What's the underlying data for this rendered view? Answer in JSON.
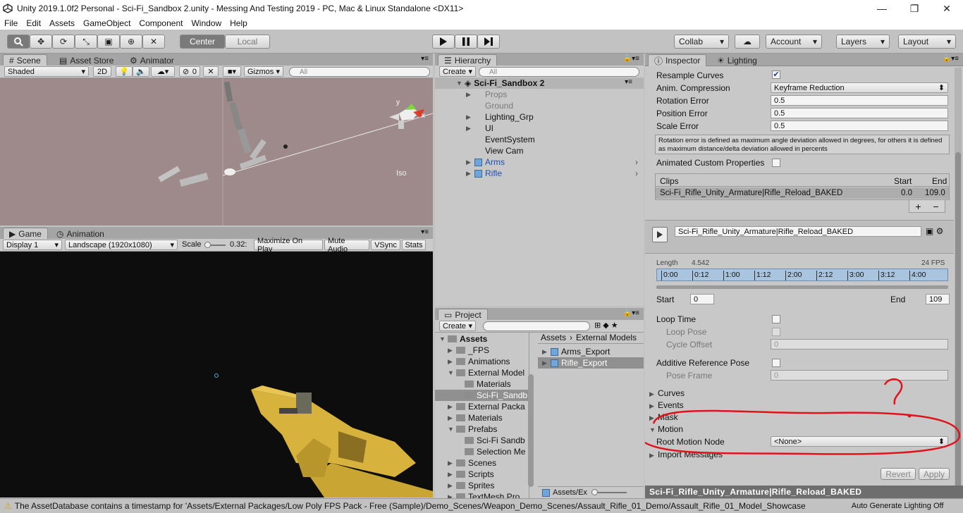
{
  "window": {
    "title": "Unity 2019.1.0f2 Personal - Sci-Fi_Sandbox 2.unity - Messing And Testing 2019 - PC, Mac & Linux Standalone <DX11>",
    "min": "—",
    "max": "❐",
    "close": "✕"
  },
  "menu": [
    "File",
    "Edit",
    "Assets",
    "GameObject",
    "Component",
    "Window",
    "Help"
  ],
  "toolbar": {
    "center": "Center",
    "local": "Local",
    "collab": "Collab",
    "account": "Account",
    "layers": "Layers",
    "layout": "Layout"
  },
  "scene": {
    "tabs": [
      "Scene",
      "Asset Store",
      "Animator"
    ],
    "shaded": "Shaded",
    "mode2d": "2D",
    "fx_count": "0",
    "gizmos": "Gizmos",
    "search_placeholder": "All",
    "iso": "Iso",
    "gizmo_y": "y",
    "gizmo_x": "x"
  },
  "game": {
    "tabs": [
      "Game",
      "Animation"
    ],
    "display": "Display 1",
    "aspect": "Landscape (1920x1080)",
    "scale_label": "Scale",
    "scale_value": "0.32:",
    "maximize": "Maximize On Play",
    "mute": "Mute Audio",
    "vsync": "VSync",
    "stats": "Stats"
  },
  "hierarchy": {
    "tab": "Hierarchy",
    "create": "Create",
    "search_placeholder": "All",
    "scene_name": "Sci-Fi_Sandbox 2",
    "items": [
      {
        "label": "Props",
        "expand": true,
        "dim": true
      },
      {
        "label": "Ground",
        "expand": false,
        "dim": true
      },
      {
        "label": "Lighting_Grp",
        "expand": true
      },
      {
        "label": "UI",
        "expand": true
      },
      {
        "label": "EventSystem",
        "expand": false
      },
      {
        "label": "View Cam",
        "expand": false
      },
      {
        "label": "Arms",
        "expand": true,
        "prefab": true
      },
      {
        "label": "Rifle",
        "expand": true,
        "prefab": true
      }
    ]
  },
  "project": {
    "tab": "Project",
    "create": "Create",
    "tree": [
      {
        "label": "Assets",
        "level": 0,
        "open": true,
        "bold": true
      },
      {
        "label": "_FPS",
        "level": 1
      },
      {
        "label": "Animations",
        "level": 1
      },
      {
        "label": "External Model",
        "level": 1,
        "open": true
      },
      {
        "label": "Materials",
        "level": 2
      },
      {
        "label": "Sci-Fi_Sandb",
        "level": 2,
        "selected": true
      },
      {
        "label": "External Packa",
        "level": 1
      },
      {
        "label": "Materials",
        "level": 1
      },
      {
        "label": "Prefabs",
        "level": 1,
        "open": true
      },
      {
        "label": "Sci-Fi Sandb",
        "level": 2
      },
      {
        "label": "Selection Me",
        "level": 2
      },
      {
        "label": "Scenes",
        "level": 1
      },
      {
        "label": "Scripts",
        "level": 1
      },
      {
        "label": "Sprites",
        "level": 1
      },
      {
        "label": "TextMesh Pro",
        "level": 1
      }
    ],
    "breadcrumb": [
      "Assets",
      "External Models"
    ],
    "files": [
      "Arms_Export",
      "Rifle_Export"
    ],
    "footer_path": "Assets/Ex"
  },
  "inspector": {
    "tabs": [
      "Inspector",
      "Lighting"
    ],
    "resample_label": "Resample Curves",
    "anim_comp_label": "Anim. Compression",
    "anim_comp_value": "Keyframe Reduction",
    "rot_err_label": "Rotation Error",
    "rot_err": "0.5",
    "pos_err_label": "Position Error",
    "pos_err": "0.5",
    "scale_err_label": "Scale Error",
    "scale_err": "0.5",
    "help_text": "Rotation error is defined as maximum angle deviation allowed in degrees, for others it is defined as maximum distance/delta deviation allowed in percents",
    "animated_custom": "Animated Custom Properties",
    "clips_header": "Clips",
    "start_header": "Start",
    "end_header": "End",
    "clip_name": "Sci-Fi_Rifle_Unity_Armature|Rifle_Reload_BAKED",
    "clip_start": "0.0",
    "clip_end": "109.0",
    "add": "+",
    "remove": "−",
    "clip_field": "Sci-Fi_Rifle_Unity_Armature|Rifle_Reload_BAKED",
    "length_label": "Length",
    "length_value": "4.542",
    "fps": "24 FPS",
    "timeline": [
      "0:00",
      "0:12",
      "1:00",
      "1:12",
      "2:00",
      "2:12",
      "3:00",
      "3:12",
      "4:00"
    ],
    "start_label": "Start",
    "start_value": "0",
    "end_label": "End",
    "end_value": "109",
    "loop_time": "Loop Time",
    "loop_pose": "Loop Pose",
    "cycle_offset": "Cycle Offset",
    "cycle_offset_value": "0",
    "additive": "Additive Reference Pose",
    "pose_frame": "Pose Frame",
    "pose_frame_value": "0",
    "foldouts": [
      "Curves",
      "Events",
      "Mask",
      "Motion"
    ],
    "root_motion_label": "Root Motion Node",
    "root_motion_value": "<None>",
    "import_messages": "Import Messages",
    "revert": "Revert",
    "apply": "Apply",
    "preview_title": "Sci-Fi_Rifle_Unity_Armature|Rifle_Reload_BAKED",
    "annotation": "?"
  },
  "status": {
    "message": "The AssetDatabase contains a timestamp for 'Assets/External Packages/Low Poly FPS Pack - Free (Sample)/Demo_Scenes/Weapon_Demo_Scenes/Assault_Rifle_01_Demo/Assault_Rifle_01_Model_Showcase",
    "lighting": "Auto Generate Lighting Off"
  },
  "colors": {
    "annotation_red": "#e0121a",
    "scene_bg": "#9e8a8a",
    "game_bg": "#0d0d0d",
    "rifle_gold": "#d7b23c",
    "prefab_blue": "#1f4fb0"
  }
}
